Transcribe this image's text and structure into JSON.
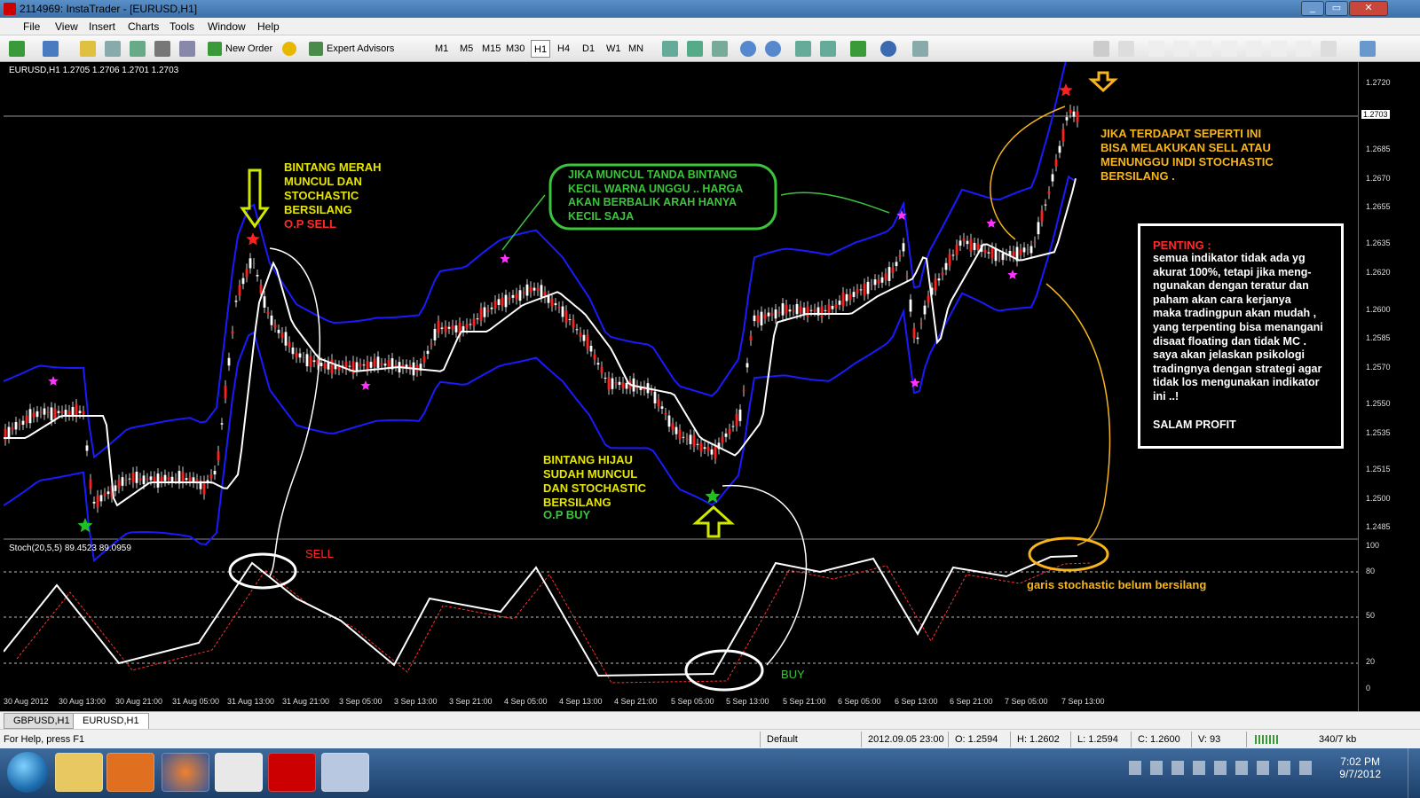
{
  "window": {
    "title": "2114969: InstaTrader - [EURUSD,H1]"
  },
  "menu": [
    "File",
    "View",
    "Insert",
    "Charts",
    "Tools",
    "Window",
    "Help"
  ],
  "toolbar": {
    "new_order": "New Order",
    "expert_advisors": "Expert Advisors",
    "timeframes": [
      "M1",
      "M5",
      "M15",
      "M30",
      "H1",
      "H4",
      "D1",
      "W1",
      "MN"
    ],
    "active_timeframe": "H1"
  },
  "chart": {
    "info": "EURUSD,H1  1.2705 1.2706 1.2701 1.2703",
    "current_price": "1.2703",
    "price_labels": [
      "1.2720",
      "1.2685",
      "1.2670",
      "1.2655",
      "1.2635",
      "1.2620",
      "1.2600",
      "1.2585",
      "1.2570",
      "1.2550",
      "1.2535",
      "1.2515",
      "1.2500",
      "1.2485"
    ],
    "stoch_info": "Stoch(20,5,5) 89.4523 89.0959",
    "stoch_labels": [
      "100",
      "80",
      "50",
      "20",
      "0"
    ],
    "time_labels": [
      "30 Aug 2012",
      "30 Aug 13:00",
      "30 Aug 21:00",
      "31 Aug 05:00",
      "31 Aug 13:00",
      "31 Aug 21:00",
      "3 Sep 05:00",
      "3 Sep 13:00",
      "3 Sep 21:00",
      "4 Sep 05:00",
      "4 Sep 13:00",
      "4 Sep 21:00",
      "5 Sep 05:00",
      "5 Sep 13:00",
      "5 Sep 21:00",
      "6 Sep 05:00",
      "6 Sep 13:00",
      "6 Sep 21:00",
      "7 Sep 05:00",
      "7 Sep 13:00"
    ]
  },
  "annotations": {
    "red_star": [
      "BINTANG MERAH",
      "MUNCUL DAN",
      "STOCHASTIC",
      "BERSILANG"
    ],
    "op_sell": "O.P SELL",
    "purple_star": [
      "JIKA MUNCUL TANDA BINTANG",
      "KECIL WARNA UNGGU .. HARGA",
      "AKAN BERBALIK ARAH HANYA",
      "KECIL SAJA"
    ],
    "green_star": [
      "BINTANG HIJAU",
      "SUDAH MUNCUL",
      "DAN STOCHASTIC",
      "BERSILANG"
    ],
    "op_buy": "O.P BUY",
    "top_right": [
      "JIKA TERDAPAT SEPERTI INI",
      "BISA MELAKUKAN SELL ATAU",
      "MENUNGGU INDI STOCHASTIC",
      "BERSILANG ."
    ],
    "sell": "SELL",
    "buy": "BUY",
    "stoch_note": "garis stochastic belum bersilang",
    "note_title": "PENTING :",
    "note_body": [
      "semua indikator tidak ada yg",
      "akurat 100%, tetapi jika meng-",
      "ngunakan dengan teratur dan",
      "paham akan cara kerjanya",
      "maka tradingpun akan mudah ,",
      "yang terpenting bisa menangani",
      "disaat floating dan tidak MC .",
      "saya akan jelaskan psikologi",
      "tradingnya dengan strategi agar",
      "tidak los mengunakan indikator",
      "ini ..!"
    ],
    "note_footer": "SALAM PROFIT"
  },
  "tabs": [
    "GBPUSD,H1",
    "EURUSD,H1"
  ],
  "active_tab": "EURUSD,H1",
  "status": {
    "help": "For Help, press F1",
    "profile": "Default",
    "datetime": "2012.09.05 23:00",
    "open": "O: 1.2594",
    "high": "H: 1.2602",
    "low": "L: 1.2594",
    "close": "C: 1.2600",
    "volume": "V: 93",
    "traffic": "340/7 kb"
  },
  "clock": {
    "time": "7:02 PM",
    "date": "9/7/2012"
  },
  "colors": {
    "candle": "#ff2020",
    "channel": "#1a1aff",
    "stoch_main": "#ffffff",
    "stoch_signal": "#ff3030",
    "annotation": "#e6e600"
  }
}
